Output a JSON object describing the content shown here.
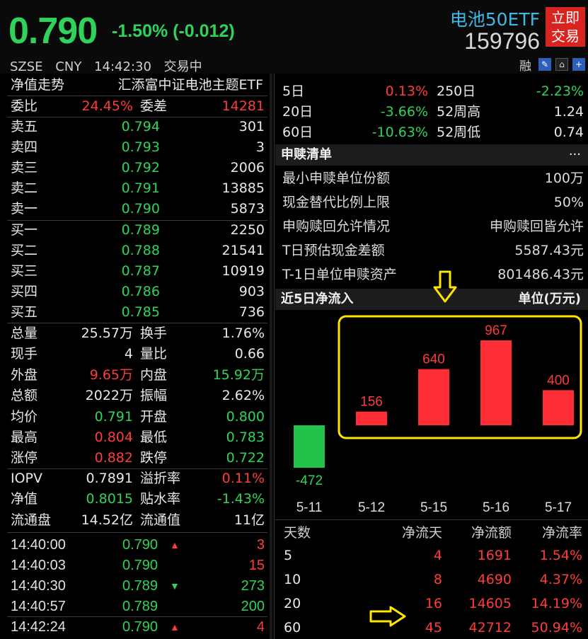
{
  "header": {
    "price": "0.790",
    "change": "-1.50% (-0.012)",
    "exchange": "SZSE",
    "currency": "CNY",
    "time": "14:42:30",
    "status": "交易中",
    "fund_name": "电池50ETF",
    "fund_code": "159796",
    "trade_button": "立即\n交易",
    "trade_line1": "立即",
    "trade_line2": "交易",
    "rong": "融"
  },
  "left": {
    "nav_label": "净值走势",
    "fund_full_name": "汇添富中证电池主题ETF",
    "weibi_label": "委比",
    "weibi_value": "24.45%",
    "weicha_label": "委差",
    "weicha_value": "14281",
    "sells": [
      {
        "label": "卖五",
        "price": "0.794",
        "vol": "301"
      },
      {
        "label": "卖四",
        "price": "0.793",
        "vol": "3"
      },
      {
        "label": "卖三",
        "price": "0.792",
        "vol": "2006"
      },
      {
        "label": "卖二",
        "price": "0.791",
        "vol": "13885"
      },
      {
        "label": "卖一",
        "price": "0.790",
        "vol": "5873"
      }
    ],
    "buys": [
      {
        "label": "买一",
        "price": "0.789",
        "vol": "2250"
      },
      {
        "label": "买二",
        "price": "0.788",
        "vol": "21541"
      },
      {
        "label": "买三",
        "price": "0.787",
        "vol": "10919"
      },
      {
        "label": "买四",
        "price": "0.786",
        "vol": "903"
      },
      {
        "label": "买五",
        "price": "0.785",
        "vol": "736"
      }
    ],
    "stats": [
      {
        "k1": "总量",
        "v1": "25.57万",
        "c1": "white",
        "k2": "换手",
        "v2": "1.76%",
        "c2": "white"
      },
      {
        "k1": "现手",
        "v1": "4",
        "c1": "white",
        "k2": "量比",
        "v2": "0.66",
        "c2": "white"
      },
      {
        "k1": "外盘",
        "v1": "9.65万",
        "c1": "red",
        "k2": "内盘",
        "v2": "15.92万",
        "c2": "green"
      },
      {
        "k1": "总额",
        "v1": "2022万",
        "c1": "white",
        "k2": "振幅",
        "v2": "2.62%",
        "c2": "white"
      },
      {
        "k1": "均价",
        "v1": "0.791",
        "c1": "green",
        "k2": "开盘",
        "v2": "0.800",
        "c2": "green"
      },
      {
        "k1": "最高",
        "v1": "0.804",
        "c1": "red",
        "k2": "最低",
        "v2": "0.783",
        "c2": "green"
      },
      {
        "k1": "涨停",
        "v1": "0.882",
        "c1": "red",
        "k2": "跌停",
        "v2": "0.722",
        "c2": "green"
      }
    ],
    "stats2": [
      {
        "k1": "IOPV",
        "v1": "0.7891",
        "c1": "white",
        "k2": "溢折率",
        "v2": "0.11%",
        "c2": "red"
      },
      {
        "k1": "净值",
        "v1": "0.8015",
        "c1": "green",
        "k2": "贴水率",
        "v2": "-1.43%",
        "c2": "green"
      },
      {
        "k1": "流通盘",
        "v1": "14.52亿",
        "c1": "white",
        "k2": "流通值",
        "v2": "11亿",
        "c2": "white"
      }
    ],
    "ticks": [
      {
        "time": "14:40:00",
        "price": "0.790",
        "arrow": "up",
        "vol": "3",
        "vc": "red"
      },
      {
        "time": "14:40:03",
        "price": "0.790",
        "arrow": "",
        "vol": "15",
        "vc": "red"
      },
      {
        "time": "14:40:30",
        "price": "0.789",
        "arrow": "down",
        "vol": "273",
        "vc": "green"
      },
      {
        "time": "14:40:57",
        "price": "0.789",
        "arrow": "",
        "vol": "200",
        "vc": "green"
      },
      {
        "time": "14:42:24",
        "price": "0.790",
        "arrow": "up",
        "vol": "4",
        "vc": "red"
      }
    ]
  },
  "right": {
    "perf": [
      {
        "k1": "5日",
        "v1": "0.13%",
        "c1": "red",
        "k2": "250日",
        "v2": "-2.23%",
        "c2": "green"
      },
      {
        "k1": "20日",
        "v1": "-3.66%",
        "c1": "green",
        "k2": "52周高",
        "v2": "1.24",
        "c2": "white"
      },
      {
        "k1": "60日",
        "v1": "-10.63%",
        "c1": "green",
        "k2": "52周低",
        "v2": "0.74",
        "c2": "white"
      }
    ],
    "redeem_title": "申赎清单",
    "more": "···",
    "redeem": [
      {
        "k": "最小申赎单位份额",
        "v": "100万"
      },
      {
        "k": "现金替代比例上限",
        "v": "50%"
      },
      {
        "k": "申购赎回允许情况",
        "v": "申购赎回皆允许"
      },
      {
        "k": "T日预估现金差额",
        "v": "5587.43元"
      },
      {
        "k": "T-1日单位申赎资产",
        "v": "801486.43元"
      }
    ],
    "flow_title": "近5日净流入",
    "flow_unit": "单位(万元)",
    "flow_table_head": {
      "days": "天数",
      "net_days": "净流天",
      "net_amt": "净流额",
      "net_rate": "净流率"
    },
    "flow_table": [
      {
        "days": "5",
        "net_days": "4",
        "net_amt": "1691",
        "net_rate": "1.54%"
      },
      {
        "days": "10",
        "net_days": "8",
        "net_amt": "4690",
        "net_rate": "4.37%"
      },
      {
        "days": "20",
        "net_days": "16",
        "net_amt": "14605",
        "net_rate": "14.19%"
      },
      {
        "days": "60",
        "net_days": "45",
        "net_amt": "42712",
        "net_rate": "50.94%"
      }
    ]
  },
  "chart_data": {
    "type": "bar",
    "categories": [
      "5-11",
      "5-12",
      "5-15",
      "5-16",
      "5-17"
    ],
    "values": [
      -472,
      156,
      640,
      967,
      400
    ],
    "title": "近5日净流入",
    "ylabel": "单位(万元)",
    "colors": {
      "positive": "#ff2d36",
      "negative": "#22c24b"
    }
  },
  "colors": {
    "up": "#ff3b3b",
    "down": "#2fd35a",
    "accent": "#3fb8e8",
    "trade": "#d8231f",
    "annotation": "#ffe600"
  }
}
